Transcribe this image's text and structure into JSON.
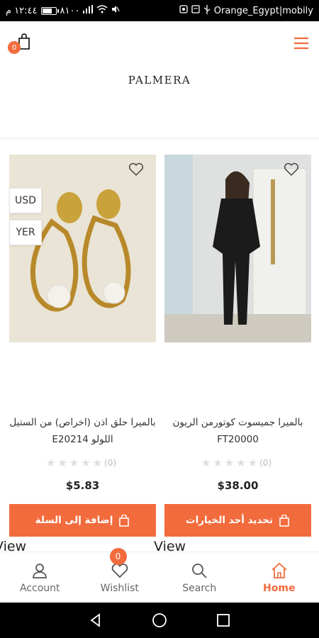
{
  "status_bar": {
    "time": "١٢:٤٤ م",
    "battery": "٨١٠٠",
    "battery_level": 0.81,
    "carrier": "Orange_Egypt|mobily"
  },
  "header": {
    "cart_count": "0",
    "logo": "PALMERA"
  },
  "currency_options": [
    "USD",
    "YER"
  ],
  "products": [
    {
      "name": "بالميرا حلق اذن (اخراص) من الستيل اللولو E20214",
      "rating_count": "(0)",
      "price": "$5.83",
      "action_label": "إضافة إلى السلة"
    },
    {
      "name": "بالميرا جميسوت كوتورمن الريون FT20000",
      "rating_count": "(0)",
      "price": "$38.00",
      "action_label": "تحديد أحد الخيارات"
    }
  ],
  "view_label": "View",
  "bottom_nav": {
    "items": [
      {
        "label": "Account",
        "icon": "user-icon"
      },
      {
        "label": "Wishlist",
        "icon": "heart-icon",
        "badge": "0"
      },
      {
        "label": "Search",
        "icon": "search-icon"
      },
      {
        "label": "Home",
        "icon": "home-icon",
        "active": true
      }
    ]
  },
  "colors": {
    "accent": "#f26b3d"
  }
}
